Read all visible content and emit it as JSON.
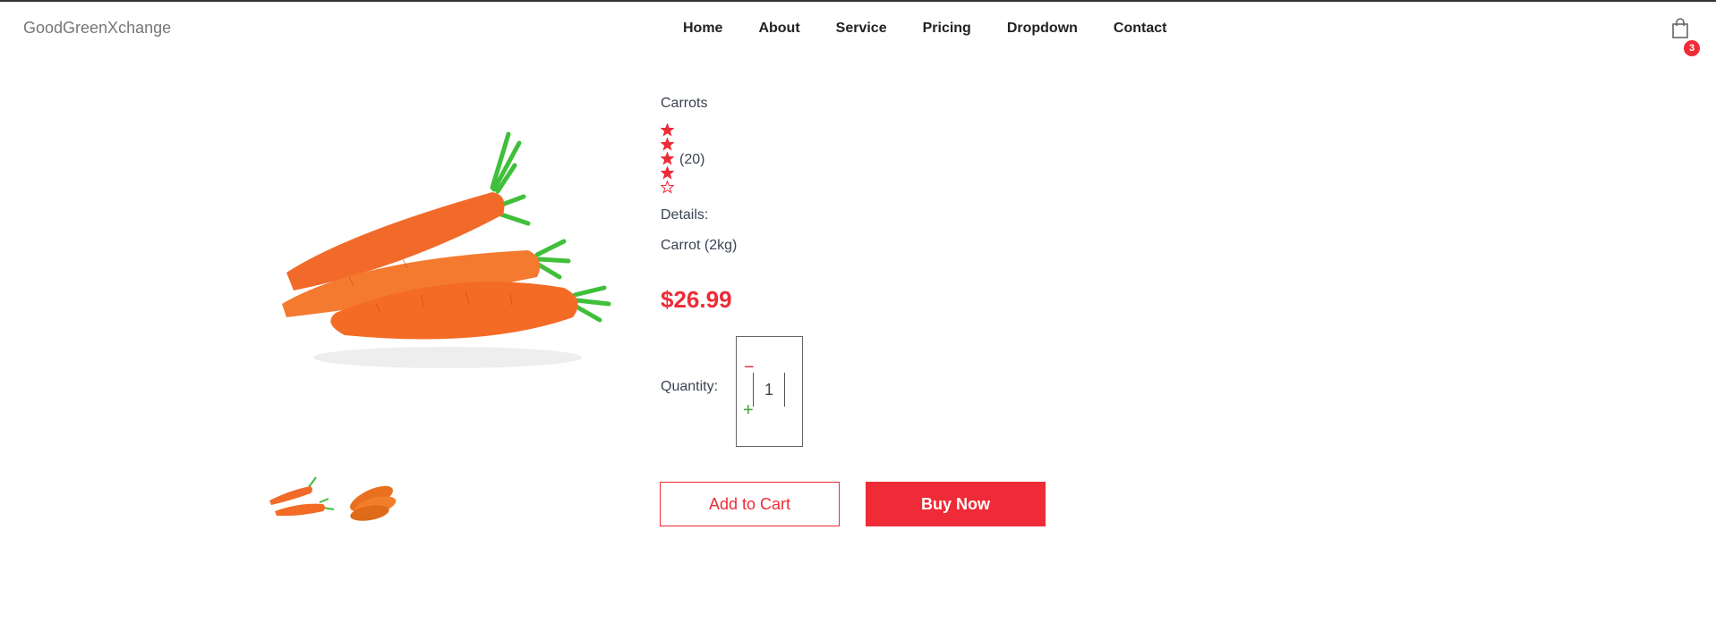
{
  "brand": "GoodGreenXchange",
  "nav": {
    "items": [
      "Home",
      "About",
      "Service",
      "Pricing",
      "Dropdown",
      "Contact"
    ]
  },
  "cart": {
    "icon": "shopping-bag-icon",
    "count": "3"
  },
  "product": {
    "name": "Carrots",
    "rating": {
      "filled": 4,
      "total": 5,
      "reviews": "(20)"
    },
    "details_label": "Details:",
    "details_value": "Carrot (2kg)",
    "price": "$26.99",
    "quantity_label": "Quantity:",
    "quantity": "1",
    "decrement_symbol": "−",
    "increment_symbol": "+"
  },
  "actions": {
    "add_to_cart": "Add to Cart",
    "buy_now": "Buy Now"
  },
  "colors": {
    "accent": "#ee2b37",
    "plus": "#3aa03a",
    "carrot": "#f26a2a",
    "leaf": "#3fbf3a"
  }
}
